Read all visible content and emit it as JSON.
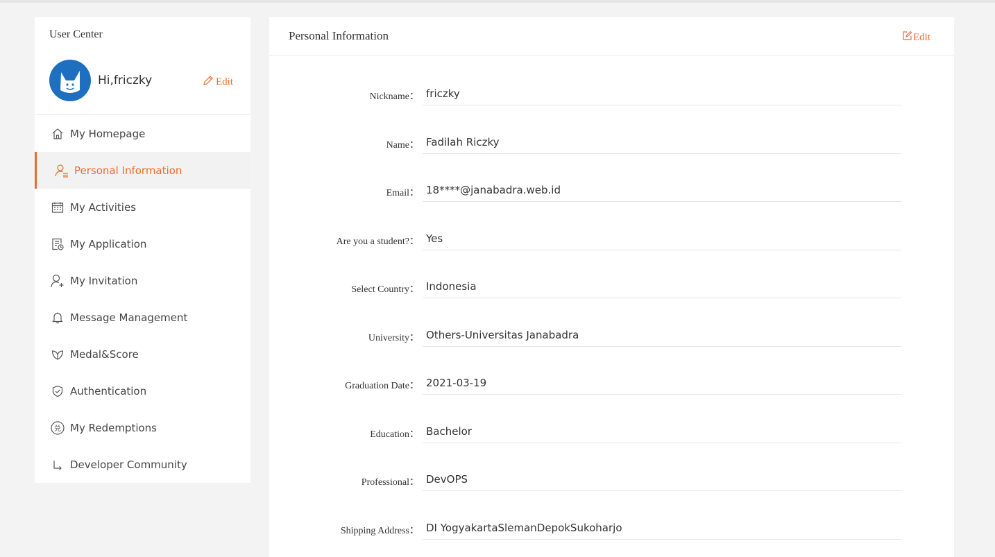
{
  "sidebar": {
    "title": "User Center",
    "greeting": "Hi,friczky",
    "edit_label": "Edit",
    "items": [
      {
        "label": "My Homepage",
        "icon": "home-icon"
      },
      {
        "label": "Personal Information",
        "icon": "user-list-icon",
        "active": true
      },
      {
        "label": "My Activities",
        "icon": "calendar-icon"
      },
      {
        "label": "My Application",
        "icon": "document-clock-icon"
      },
      {
        "label": "My Invitation",
        "icon": "user-plus-icon"
      },
      {
        "label": "Message Management",
        "icon": "bell-icon"
      },
      {
        "label": "Medal&Score",
        "icon": "leaf-icon"
      },
      {
        "label": "Authentication",
        "icon": "shield-check-icon"
      },
      {
        "label": "My Redemptions",
        "icon": "redeem-coin-icon"
      },
      {
        "label": "Developer Community",
        "icon": "corner-arrow-icon"
      }
    ]
  },
  "main": {
    "title": "Personal Information",
    "edit_label": "Edit",
    "fields": [
      {
        "label": "Nickname：",
        "value": "friczky"
      },
      {
        "label": "Name：",
        "value": "Fadilah Riczky"
      },
      {
        "label": "Email：",
        "value": "18****@janabadra.web.id"
      },
      {
        "label": "Are you a student?：",
        "value": "Yes"
      },
      {
        "label": "Select Country：",
        "value": "Indonesia"
      },
      {
        "label": "University：",
        "value": "Others-Universitas Janabadra"
      },
      {
        "label": "Graduation Date：",
        "value": "2021-03-19"
      },
      {
        "label": "Education：",
        "value": "Bachelor"
      },
      {
        "label": "Professional：",
        "value": "DevOPS"
      },
      {
        "label": "Shipping Address：",
        "value": "DI YogyakartaSlemanDepokSukoharjo"
      }
    ]
  },
  "colors": {
    "accent": "#ee6b2e",
    "avatar_bg": "#1f6fc0",
    "page_bg": "#f3f3f3"
  }
}
